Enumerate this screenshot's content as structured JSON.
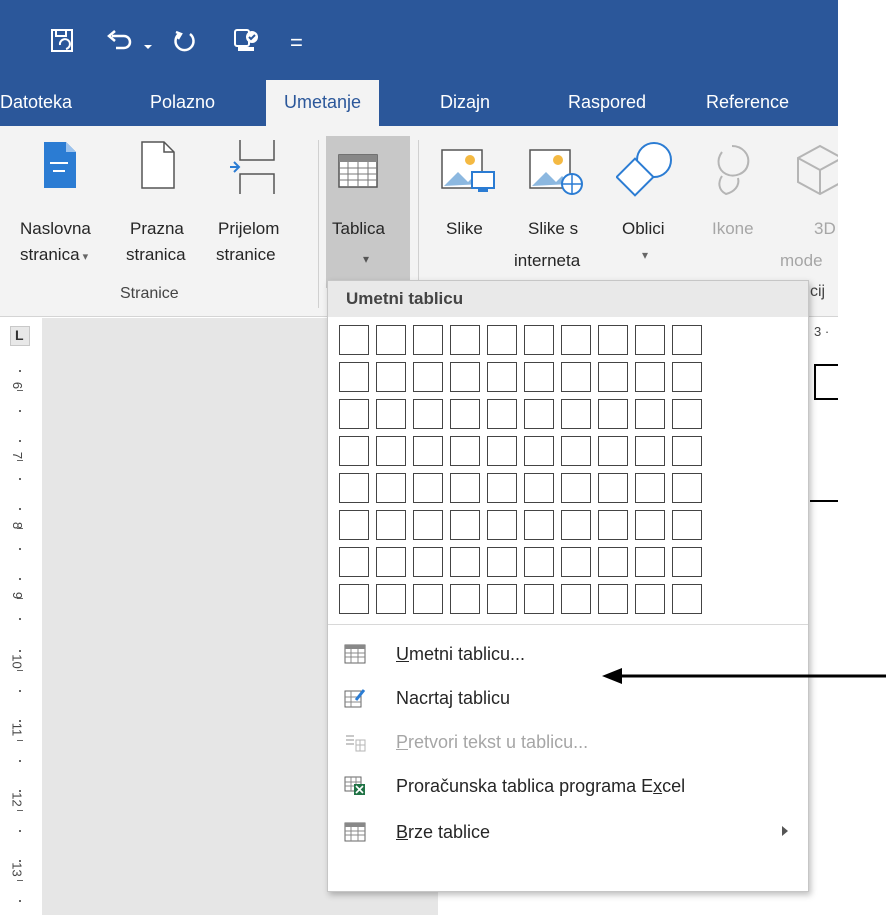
{
  "quick_access": {
    "dropdown_glyph": "="
  },
  "tabs": [
    {
      "label": "Datoteka",
      "active": false
    },
    {
      "label": "Polazno",
      "active": false
    },
    {
      "label": "Umetanje",
      "active": true
    },
    {
      "label": "Dizajn",
      "active": false
    },
    {
      "label": "Raspored",
      "active": false
    },
    {
      "label": "Reference",
      "active": false
    }
  ],
  "ribbon": {
    "pages_group": {
      "label": "Stranice",
      "cover_page": {
        "line1": "Naslovna",
        "line2": "stranica"
      },
      "blank_page": {
        "line1": "Prazna",
        "line2": "stranica"
      },
      "page_break": {
        "line1": "Prijelom",
        "line2": "stranice"
      }
    },
    "table_button": {
      "label": "Tablica"
    },
    "illustrations": {
      "pictures": "Slike",
      "online_pictures": {
        "line1": "Slike s",
        "line2": "interneta"
      },
      "shapes": "Oblici",
      "icons": "Ikone",
      "models_3d": {
        "line1": "3D",
        "line2": "mode"
      },
      "partial_group_label": "cij"
    }
  },
  "ruler": {
    "marks": [
      "6",
      "7",
      "8",
      "9",
      "10",
      "11",
      "12",
      "13"
    ],
    "tab_marker": "L"
  },
  "doc_ruler_partial": "3 ·",
  "dropdown": {
    "header": "Umetni tablicu",
    "grid": {
      "cols": 10,
      "rows": 8
    },
    "items": [
      {
        "prefix": "",
        "accel": "U",
        "rest": "metni tablicu...",
        "disabled": false,
        "submenu": false
      },
      {
        "prefix": "Nacrta",
        "accel": "j",
        "rest": " tablicu",
        "disabled": false,
        "submenu": false
      },
      {
        "prefix": "",
        "accel": "P",
        "rest": "retvori tekst u tablicu...",
        "disabled": true,
        "submenu": false
      },
      {
        "prefix": "Proračunska tablica programa E",
        "accel": "x",
        "rest": "cel",
        "disabled": false,
        "submenu": false
      },
      {
        "prefix": "",
        "accel": "B",
        "rest": "rze tablice",
        "disabled": false,
        "submenu": true
      }
    ]
  },
  "colors": {
    "ribbon_blue": "#2b579a",
    "ribbon_bg": "#f3f3f3",
    "doc_gray": "#e6e6e6"
  }
}
